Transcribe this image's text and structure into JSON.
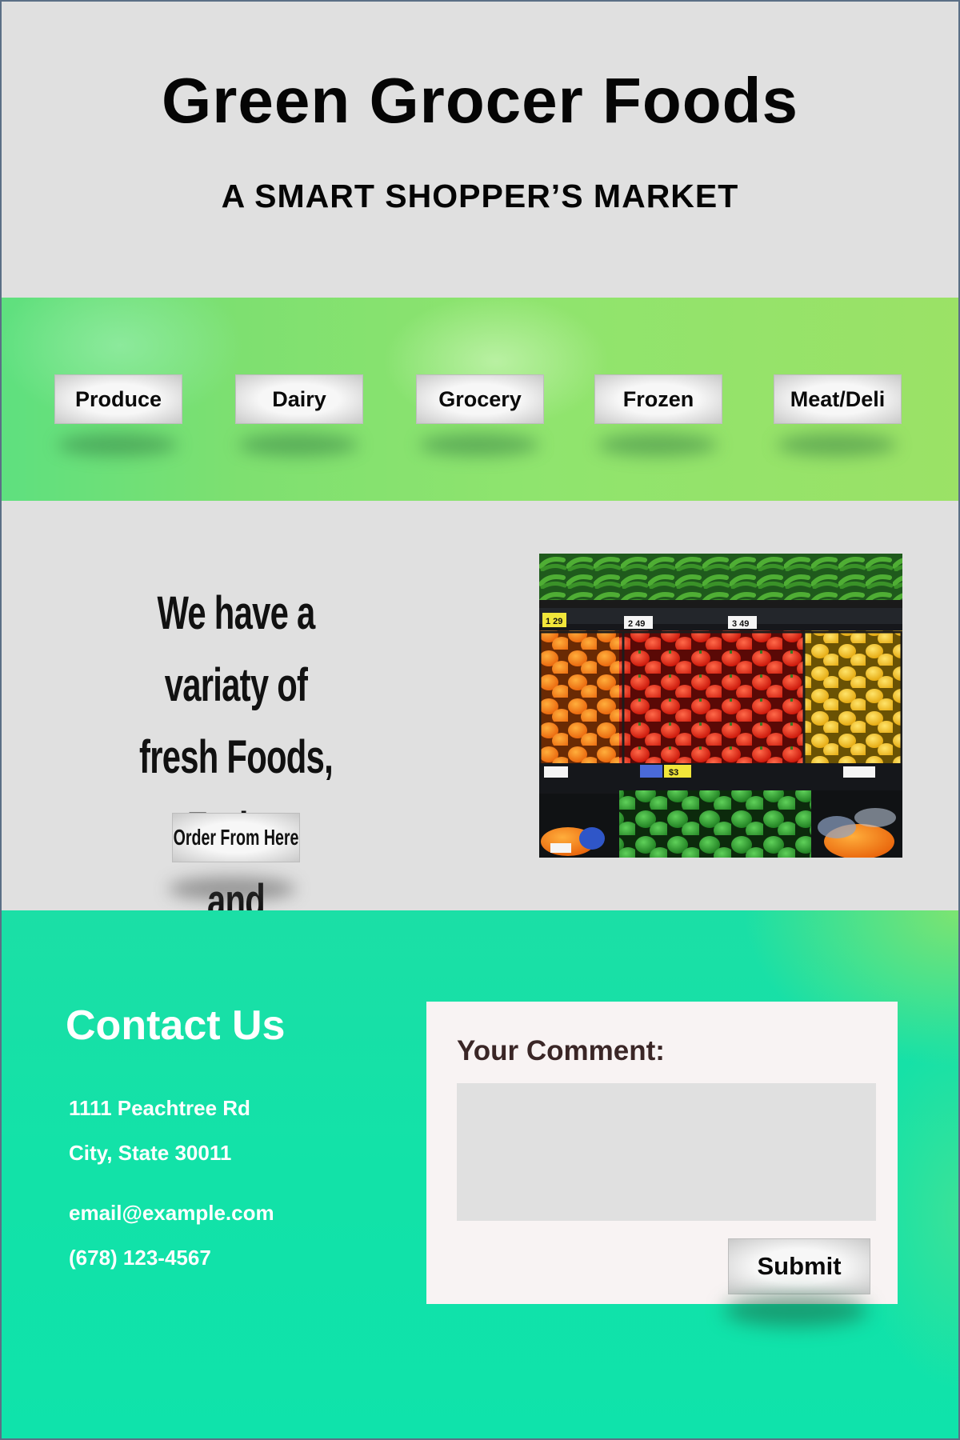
{
  "header": {
    "title": "Green Grocer Foods",
    "tagline": "A SMART SHOPPER’S MARKET"
  },
  "nav": {
    "items": [
      {
        "label": "Produce"
      },
      {
        "label": "Dairy"
      },
      {
        "label": "Grocery"
      },
      {
        "label": "Frozen"
      },
      {
        "label": "Meat/Deli"
      }
    ]
  },
  "promo": {
    "text_line1": "We have a variaty of",
    "text_line2": "fresh Foods, Fruits,",
    "text_line3": "and Vegetables.",
    "order_button": "Order From Here",
    "photo_tags": [
      "1 29",
      "2 49",
      "3 49",
      "$3"
    ]
  },
  "contact": {
    "title": "Contact Us",
    "address_line1": "1111 Peachtree Rd",
    "address_line2": "City, State 30011",
    "email": "email@example.com",
    "phone": "(678) 123-4567"
  },
  "comment_form": {
    "label": "Your Comment:",
    "value": "",
    "submit_label": "Submit"
  },
  "colors": {
    "nav_green": "#8fe46e",
    "contact_teal": "#12e2a8",
    "header_gray": "#e0e0e0"
  }
}
